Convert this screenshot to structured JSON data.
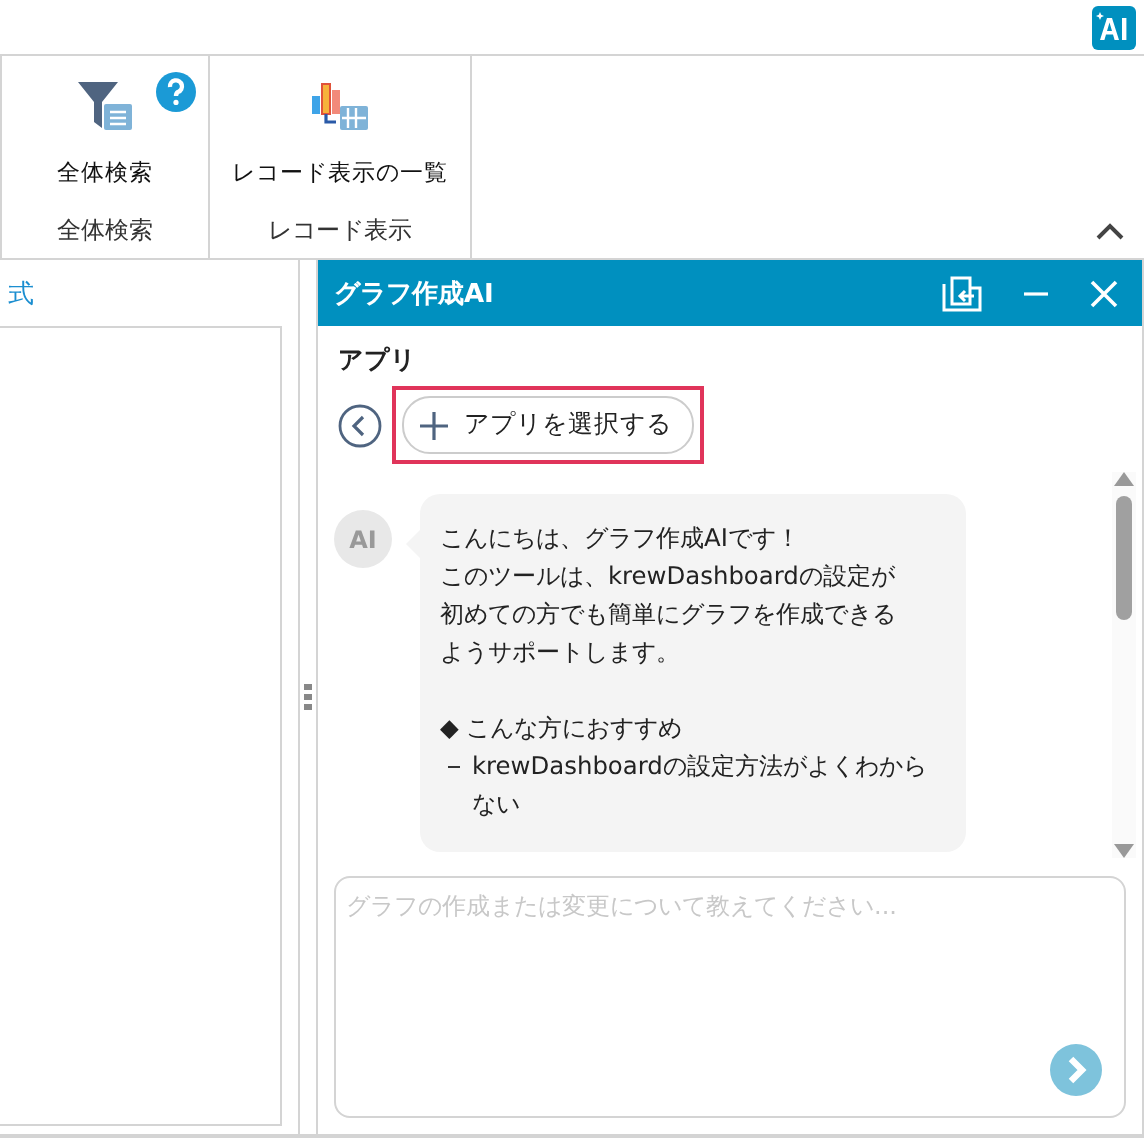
{
  "ribbon": {
    "groups": [
      {
        "label": "全体検索",
        "buttons": [
          {
            "label": "全体検索"
          }
        ],
        "help": true
      },
      {
        "label": "レコード表示",
        "buttons": [
          {
            "label": "レコード表示の一覧"
          }
        ],
        "help": false
      }
    ]
  },
  "left_panel": {
    "tab": "式"
  },
  "chat": {
    "title": "グラフ作成AI",
    "section": "アプリ",
    "select_button": {
      "label": "アプリを選択する",
      "highlighted": true
    },
    "messages": [
      {
        "avatar": "AI",
        "paragraphs": [
          [
            "こんにちは、グラフ作成AIです！",
            "このツールは、krewDashboardの設定が",
            "初めての方でも簡単にグラフを作成できる",
            "ようサポートします。"
          ],
          [
            "◆ こんな方におすすめ"
          ]
        ],
        "bullets": [
          "krewDashboardの設定方法がよくわからない"
        ]
      }
    ],
    "input": {
      "placeholder": "グラフの作成または変更について教えてください..."
    }
  }
}
